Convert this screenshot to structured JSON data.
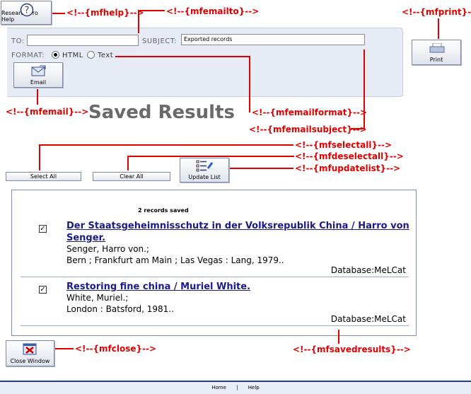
{
  "buttons": {
    "help_label": "Research Pro Help",
    "print_label": "Print",
    "email_label": "Email",
    "select_all": "Select All",
    "clear_all": "Clear All",
    "update_list": "Update List",
    "close_window": "Close Window"
  },
  "email_form": {
    "to_label": "TO:",
    "to_value": "",
    "subject_label": "SUBJECT:",
    "subject_value": "Exported records",
    "format_label": "FORMAT:",
    "format_options": [
      "HTML",
      "Text"
    ],
    "format_selected": "HTML"
  },
  "page_title": "Saved Results",
  "results": {
    "count_text": "2 records saved",
    "records": [
      {
        "checked": true,
        "title_line1": "Der Staatsgeheimnisschutz in der Volksrepublik China / Harro von",
        "title_line2": "Senger.",
        "author": "Senger, Harro von.;",
        "publication": "Bern ; Frankfurt am Main ; Las Vegas : Lang, 1979..",
        "database": "Database:MeLCat"
      },
      {
        "checked": true,
        "title_line1": "Restoring fine china / Muriel White.",
        "author": "White, Muriel.;",
        "publication": "London : Batsford, 1981..",
        "database": "Database:MeLCat"
      }
    ]
  },
  "annotations": {
    "mfhelp": "<!--{mfhelp}-->",
    "mfemailto": "<!--{mfemailto}-->",
    "mfprint": "<!--{mfprint}-->",
    "mfemail": "<!--{mfemail}-->",
    "mfemailformat": "<!--{mfemailformat}-->",
    "mfemailsubject": "<!--{mfemailsubject}-->",
    "mfselectall": "<!--{mfselectall}-->",
    "mfdeselectall": "<!--{mfdeselectall}-->",
    "mfupdatelist": "<!--{mfupdatelist}-->",
    "mfclose": "<!--{mfclose}-->",
    "mfsavedresults": "<!--{mfsavedresults}-->"
  },
  "footer": {
    "home": "Home",
    "separator": "|",
    "help": "Help"
  },
  "colors": {
    "annotation": "#e00000",
    "panel_bg": "#e7ebf5",
    "link": "#1a1a8c",
    "footer_rule": "#1f3f8f"
  }
}
